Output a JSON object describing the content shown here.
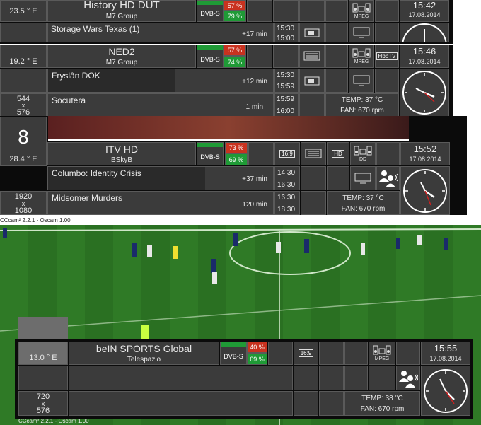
{
  "panels": [
    {
      "position": "23.5 ° E",
      "channel": "History HD DUT",
      "provider": "M7 Group",
      "system": "DVB-S",
      "strength": "57 %",
      "quality": "79 %",
      "date": "17.08.2014",
      "time": "15:42",
      "now": {
        "title": "Storage Wars Texas (1)",
        "remaining": "+17 min",
        "start": "15:30",
        "end": "15:00"
      }
    },
    {
      "position": "19.2 ° E",
      "channel": "NED2",
      "provider": "M7 Group",
      "system": "DVB-S",
      "strength": "57 %",
      "quality": "74 %",
      "date": "17.08.2014",
      "time": "15:46",
      "now": {
        "title": "Fryslân DOK",
        "remaining": "+12 min",
        "start": "15:30",
        "end": "15:59"
      },
      "next": {
        "title": "Socutera",
        "duration": "1 min",
        "start": "15:59",
        "end": "16:00"
      },
      "resolution": {
        "w": "544",
        "x": "x",
        "h": "576"
      },
      "temp": "TEMP: 37 °C",
      "fan": "FAN: 670 rpm",
      "badge": "HbbTV"
    },
    {
      "number": "8",
      "position": "28.4 ° E",
      "channel": "ITV HD",
      "provider": "BSkyB",
      "system": "DVB-S",
      "strength": "73 %",
      "quality": "69 %",
      "date": "17.08.2014",
      "time": "15:52",
      "now": {
        "title": "Columbo: Identity Crisis",
        "remaining": "+37 min",
        "start": "14:30",
        "end": "16:30"
      },
      "next": {
        "title": "Midsomer Murders",
        "duration": "120 min",
        "start": "16:30",
        "end": "18:30"
      },
      "resolution": {
        "w": "1920",
        "x": "x",
        "h": "1080"
      },
      "temp": "TEMP: 37 °C",
      "fan": "FAN: 670 rpm",
      "aspect": "16:9",
      "hd": "HD"
    },
    {
      "position": "13.0 ° E",
      "channel": "beIN SPORTS Global",
      "provider": "Telespazio",
      "system": "DVB-S",
      "strength": "40 %",
      "quality": "69 %",
      "date": "17.08.2014",
      "time": "15:55",
      "resolution": {
        "w": "720",
        "x": "x",
        "h": "576"
      },
      "temp": "TEMP: 38 °C",
      "fan": "FAN: 670 rpm",
      "aspect": "16:9"
    }
  ],
  "footer": {
    "cam1": "CCcam² 2.2.1 - Oscam 1.00",
    "cam2": "CCcam² 2.2.1 - Oscam 1.00"
  },
  "icons": {
    "mpeg": "MPEG",
    "dd": "DD"
  }
}
